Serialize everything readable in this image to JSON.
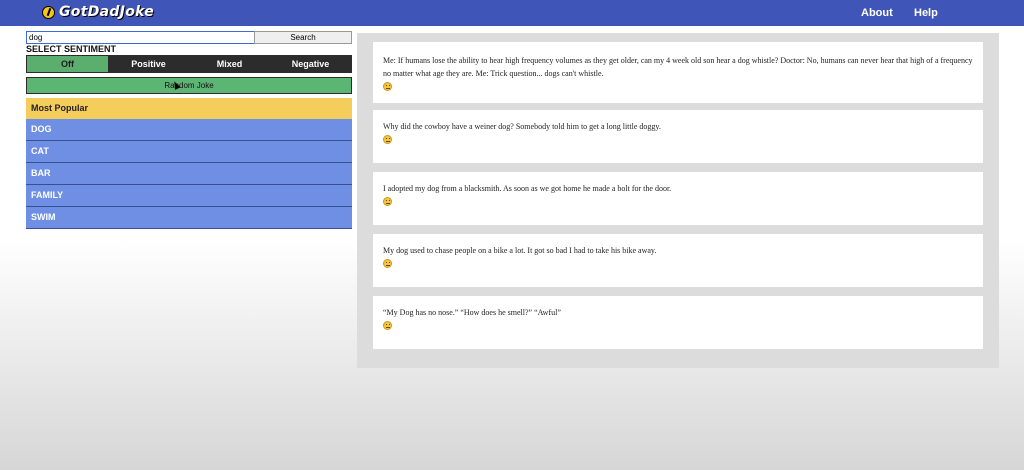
{
  "header": {
    "logo_text": "GotDadJoke",
    "nav": [
      "About",
      "Help"
    ]
  },
  "search": {
    "value": "dog",
    "button_label": "Search"
  },
  "sentiment": {
    "title": "SELECT SENTIMENT",
    "options": [
      "Off",
      "Positive",
      "Mixed",
      "Negative"
    ],
    "selected": "Off"
  },
  "random_button": "Random Joke",
  "categories": {
    "popular_label": "Most Popular",
    "items": [
      "DOG",
      "CAT",
      "BAR",
      "FAMILY",
      "SWIM"
    ]
  },
  "jokes": [
    {
      "text": "Me: If humans lose the ability to hear high frequency volumes as they get older, can my 4 week old son hear a dog whistle? Doctor: No, humans can never hear that high of a frequency no matter what age they are. Me: Trick question... dogs can't whistle.",
      "icon": "neutral-face-icon"
    },
    {
      "text": "Why did the cowboy have a weiner dog? Somebody told him to get a long little doggy.",
      "icon": "neutral-face-icon"
    },
    {
      "text": "I adopted my dog from a blacksmith. As soon as we got home he made a bolt for the door.",
      "icon": "neutral-face-icon"
    },
    {
      "text": "My dog used to chase people on a bike a lot. It got so bad I had to take his bike away.",
      "icon": "neutral-face-icon"
    },
    {
      "text": "“My Dog has no nose.” “How does he smell?” “Awful”",
      "icon": "neutral-face-icon"
    }
  ],
  "colors": {
    "header": "#3f55b8",
    "sentiment_active": "#5cae6f",
    "random_button": "#5db574",
    "popular": "#f5cd5a",
    "category": "#6f8fe5"
  }
}
